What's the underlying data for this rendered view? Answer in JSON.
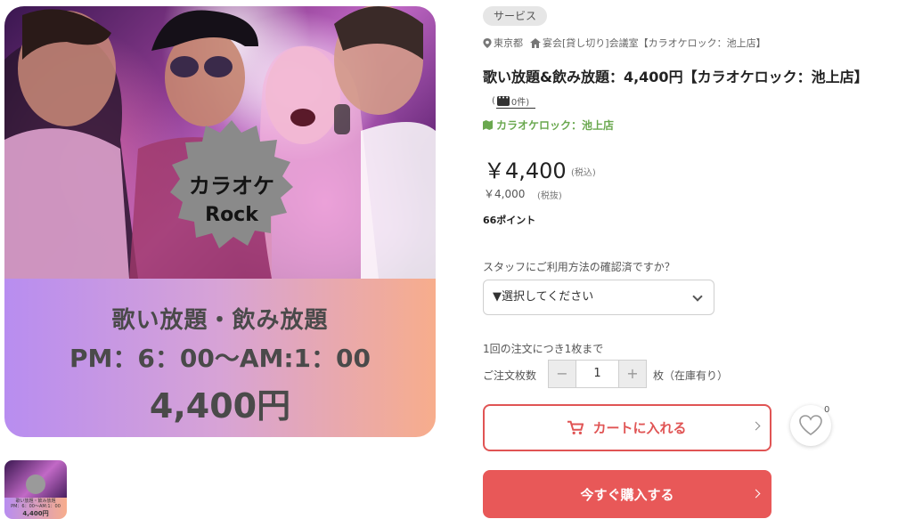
{
  "hero": {
    "badge_line1": "カラオケ",
    "badge_line2": "Rock",
    "band_line1": "歌い放題・飲み放題",
    "band_line2": "PM：6：00〜AM:1：00",
    "band_line3": "4,400円"
  },
  "thumbnail": {
    "line1": "歌い放題・飲み放題",
    "line2": "PM：6：00〜AM:1：00",
    "line3": "4,400円"
  },
  "product": {
    "category": "サービス",
    "location": "東京都",
    "venue_type": "宴会[貸し切り]会議室【カラオケロック：池上店】",
    "title": "歌い放題&飲み放題：4,400円【カラオケロック：池上店】",
    "reviews_open": "(",
    "reviews_count": "0件)",
    "shop_name": "カラオケロック：池上店",
    "price": "￥4,400",
    "price_tax_label": "(税込)",
    "price_ex": "￥4,000",
    "price_ex_label": "(税抜)",
    "points": "66ポイント"
  },
  "form": {
    "question": "スタッフにご利用方法の確認済ですか？",
    "select_value": "▼選択してください",
    "limit": "1回の注文につき1枚まで",
    "qty_label": "ご注文枚数",
    "qty_minus": "−",
    "qty_value": "1",
    "qty_plus": "+",
    "stock": "枚（在庫有り）"
  },
  "actions": {
    "cart_label": "カートに入れる",
    "buy_label": "今すぐ購入する",
    "favorite_count": "0"
  },
  "colors": {
    "accent": "#e05454",
    "shop_green": "#6aa84f"
  },
  "icons": [
    "map-pin-icon",
    "home-icon",
    "chat-icon",
    "map-icon",
    "cart-icon",
    "chevron-right-icon",
    "heart-icon",
    "chevron-down-icon"
  ]
}
